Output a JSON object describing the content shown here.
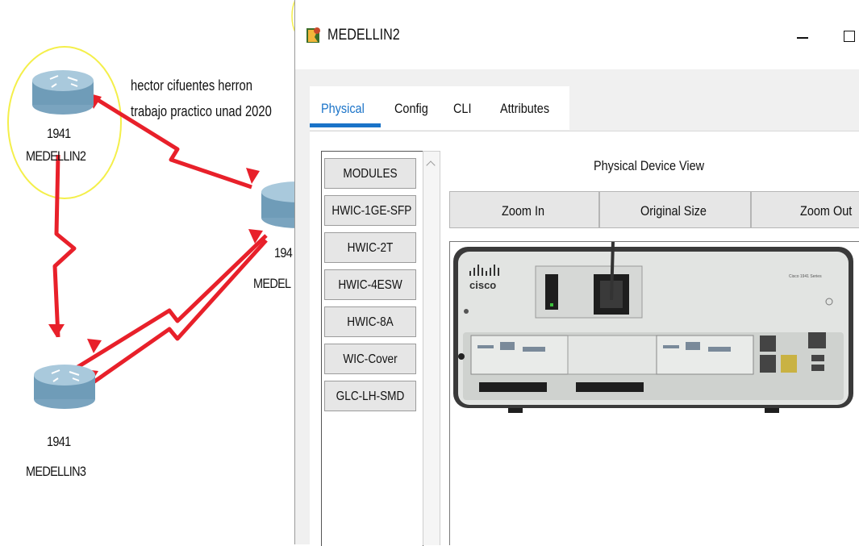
{
  "topology": {
    "note_line1": "hector cifuentes herron",
    "note_line2": "trabajo practico unad 2020",
    "routers": [
      {
        "model": "1941",
        "name": "MEDELLIN2"
      },
      {
        "model": "194",
        "name": "MEDEL"
      },
      {
        "model": "1941",
        "name": "MEDELLIN3"
      }
    ],
    "link_color": "#e8202a",
    "highlight_color": "#f4ef4a"
  },
  "window": {
    "title": "MEDELLIN2",
    "tabs": [
      "Physical",
      "Config",
      "CLI",
      "Attributes"
    ],
    "active_tab": "Physical",
    "accent": "#1a73c8",
    "modules": [
      "MODULES",
      "HWIC-1GE-SFP",
      "HWIC-2T",
      "HWIC-4ESW",
      "HWIC-8A",
      "WIC-Cover",
      "GLC-LH-SMD"
    ],
    "physical_view_title": "Physical Device View",
    "zoom_in": "Zoom In",
    "original_size": "Original Size",
    "zoom_out": "Zoom Out",
    "device": {
      "brand": "cisco",
      "series": "Cisco 1941 Series"
    }
  }
}
